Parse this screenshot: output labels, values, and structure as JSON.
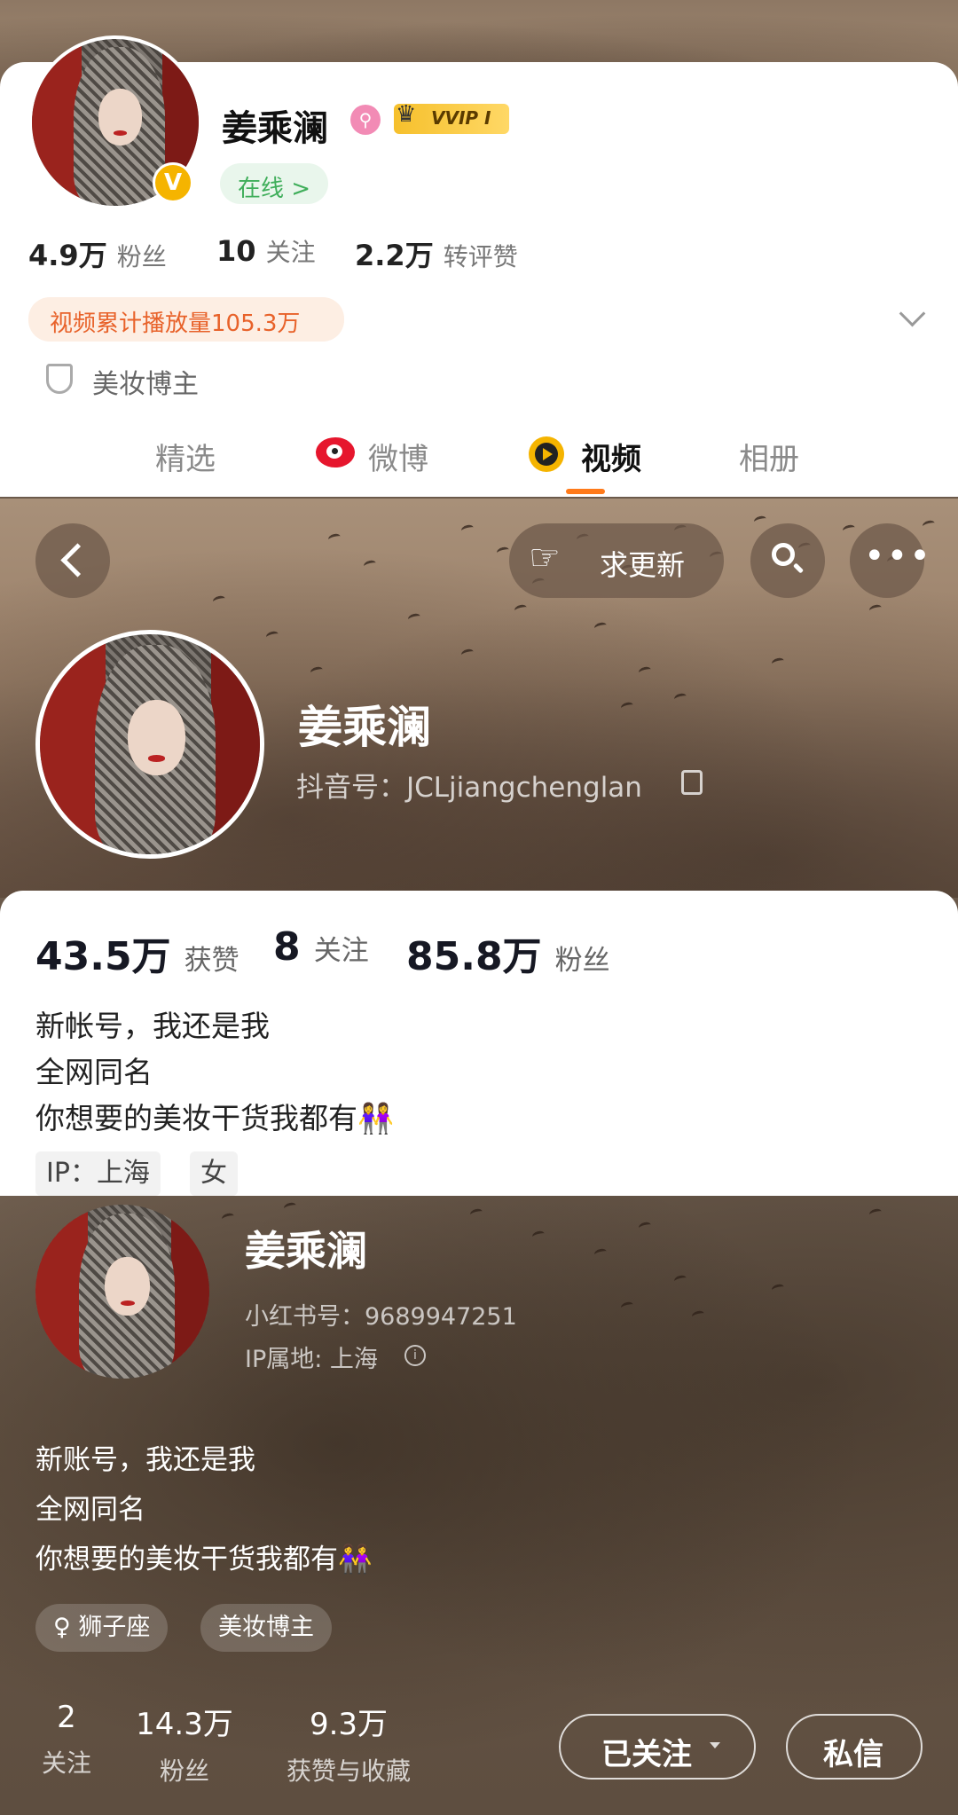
{
  "weibo": {
    "name": "姜乘澜",
    "vip_badge": "VVIP I",
    "online": "在线 >",
    "stats": [
      {
        "value": "4.9万",
        "label": "粉丝"
      },
      {
        "value": "10",
        "label": "关注"
      },
      {
        "value": "2.2万",
        "label": "转评赞"
      }
    ],
    "video_play_count": "视频累计播放量105.3万",
    "category": "美妆博主",
    "tabs": [
      "精选",
      "微博",
      "视频",
      "相册"
    ],
    "active_tab": "视频",
    "colors": {
      "accent": "#ff7a1a",
      "vip": "#f6c02c",
      "verified": "#f5b400"
    }
  },
  "douyin": {
    "request_update": "求更新",
    "name": "姜乘澜",
    "id_label": "抖音号：JCLjiangchenglan",
    "stats": [
      {
        "value": "43.5万",
        "label": "获赞"
      },
      {
        "value": "8",
        "label": "关注"
      },
      {
        "value": "85.8万",
        "label": "粉丝"
      }
    ],
    "bio": [
      "新帐号，我还是我",
      "全网同名",
      "你想要的美妆干货我都有👭"
    ],
    "tags": [
      "IP：上海",
      "女"
    ]
  },
  "xiaohongshu": {
    "name": "姜乘澜",
    "id_label": "小红书号：9689947251",
    "ip_label": "IP属地: 上海",
    "bio": [
      "新账号，我还是我",
      "全网同名",
      "你想要的美妆干货我都有👭"
    ],
    "tags": [
      "♀ 狮子座",
      "美妆博主"
    ],
    "stats": [
      {
        "value": "2",
        "label": "关注"
      },
      {
        "value": "14.3万",
        "label": "粉丝"
      },
      {
        "value": "9.3万",
        "label": "获赞与收藏"
      }
    ],
    "follow_button": "已关注",
    "message_button": "私信"
  }
}
